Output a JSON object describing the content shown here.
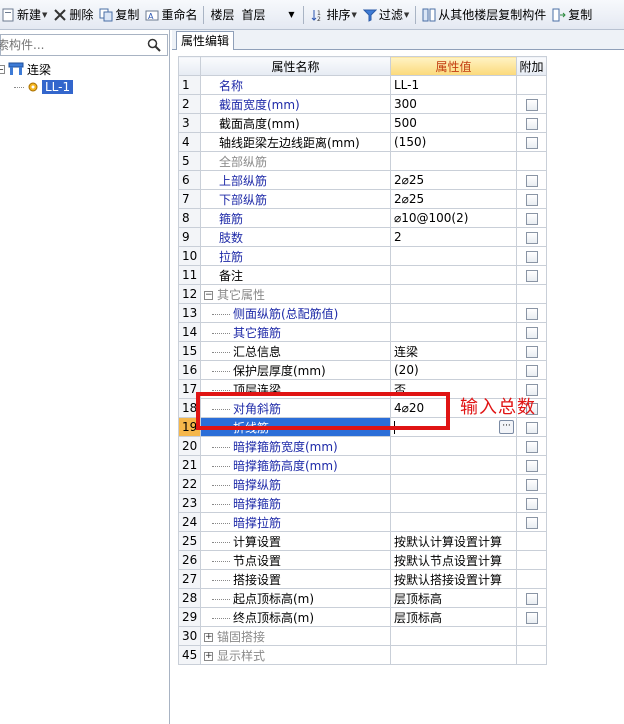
{
  "toolbar": {
    "new_label": "新建",
    "delete_label": "删除",
    "copy_label": "复制",
    "rename_label": "重命名",
    "floor_label": "楼层",
    "floor_value": "首层",
    "sort_label": "排序",
    "filter_label": "过滤",
    "copy_from_floor_label": "从其他楼层复制构件",
    "copy_to_label": "复制"
  },
  "left_panel": {
    "search_placeholder": "索构件...",
    "tree": {
      "root_label": "连梁",
      "child_label": "LL-1"
    }
  },
  "right_panel": {
    "tab_label": "属性编辑",
    "columns": {
      "name": "属性名称",
      "value": "属性值",
      "extra": "附加"
    },
    "rows": [
      {
        "idx": "1",
        "name": "名称",
        "value": "LL-1"
      },
      {
        "idx": "2",
        "name": "截面宽度(mm)",
        "value": "300"
      },
      {
        "idx": "3",
        "name": "截面高度(mm)",
        "value": "500"
      },
      {
        "idx": "4",
        "name": "轴线距梁左边线距离(mm)",
        "value": "(150)"
      },
      {
        "idx": "5",
        "name": "全部纵筋",
        "value": ""
      },
      {
        "idx": "6",
        "name": "上部纵筋",
        "value": "2⌀25"
      },
      {
        "idx": "7",
        "name": "下部纵筋",
        "value": "2⌀25"
      },
      {
        "idx": "8",
        "name": "箍筋",
        "value": "⌀10@100(2)"
      },
      {
        "idx": "9",
        "name": "肢数",
        "value": "2"
      },
      {
        "idx": "10",
        "name": "拉筋",
        "value": ""
      },
      {
        "idx": "11",
        "name": "备注",
        "value": ""
      },
      {
        "idx": "12",
        "name": "其它属性",
        "value": ""
      },
      {
        "idx": "13",
        "name": "侧面纵筋(总配筋值)",
        "value": ""
      },
      {
        "idx": "14",
        "name": "其它箍筋",
        "value": ""
      },
      {
        "idx": "15",
        "name": "汇总信息",
        "value": "连梁"
      },
      {
        "idx": "16",
        "name": "保护层厚度(mm)",
        "value": "(20)"
      },
      {
        "idx": "17",
        "name": "顶层连梁",
        "value": "否"
      },
      {
        "idx": "18",
        "name": "对角斜筋",
        "value": "4⌀20"
      },
      {
        "idx": "19",
        "name": "折线筋",
        "value": ""
      },
      {
        "idx": "20",
        "name": "暗撑箍筋宽度(mm)",
        "value": ""
      },
      {
        "idx": "21",
        "name": "暗撑箍筋高度(mm)",
        "value": ""
      },
      {
        "idx": "22",
        "name": "暗撑纵筋",
        "value": ""
      },
      {
        "idx": "23",
        "name": "暗撑箍筋",
        "value": ""
      },
      {
        "idx": "24",
        "name": "暗撑拉筋",
        "value": ""
      },
      {
        "idx": "25",
        "name": "计算设置",
        "value": "按默认计算设置计算"
      },
      {
        "idx": "26",
        "name": "节点设置",
        "value": "按默认节点设置计算"
      },
      {
        "idx": "27",
        "name": "搭接设置",
        "value": "按默认搭接设置计算"
      },
      {
        "idx": "28",
        "name": "起点顶标高(m)",
        "value": "层顶标高"
      },
      {
        "idx": "29",
        "name": "终点顶标高(m)",
        "value": "层顶标高"
      },
      {
        "idx": "30",
        "name": "锚固搭接",
        "value": ""
      },
      {
        "idx": "45",
        "name": "显示样式",
        "value": ""
      }
    ],
    "ellipsis_label": "···"
  },
  "annotation": {
    "text": "输入总数",
    "color": "#e01414"
  },
  "colors": {
    "selection": "#2b6ed8",
    "value_header": "#fbd97a",
    "blue_text": "#1e2aa8"
  }
}
